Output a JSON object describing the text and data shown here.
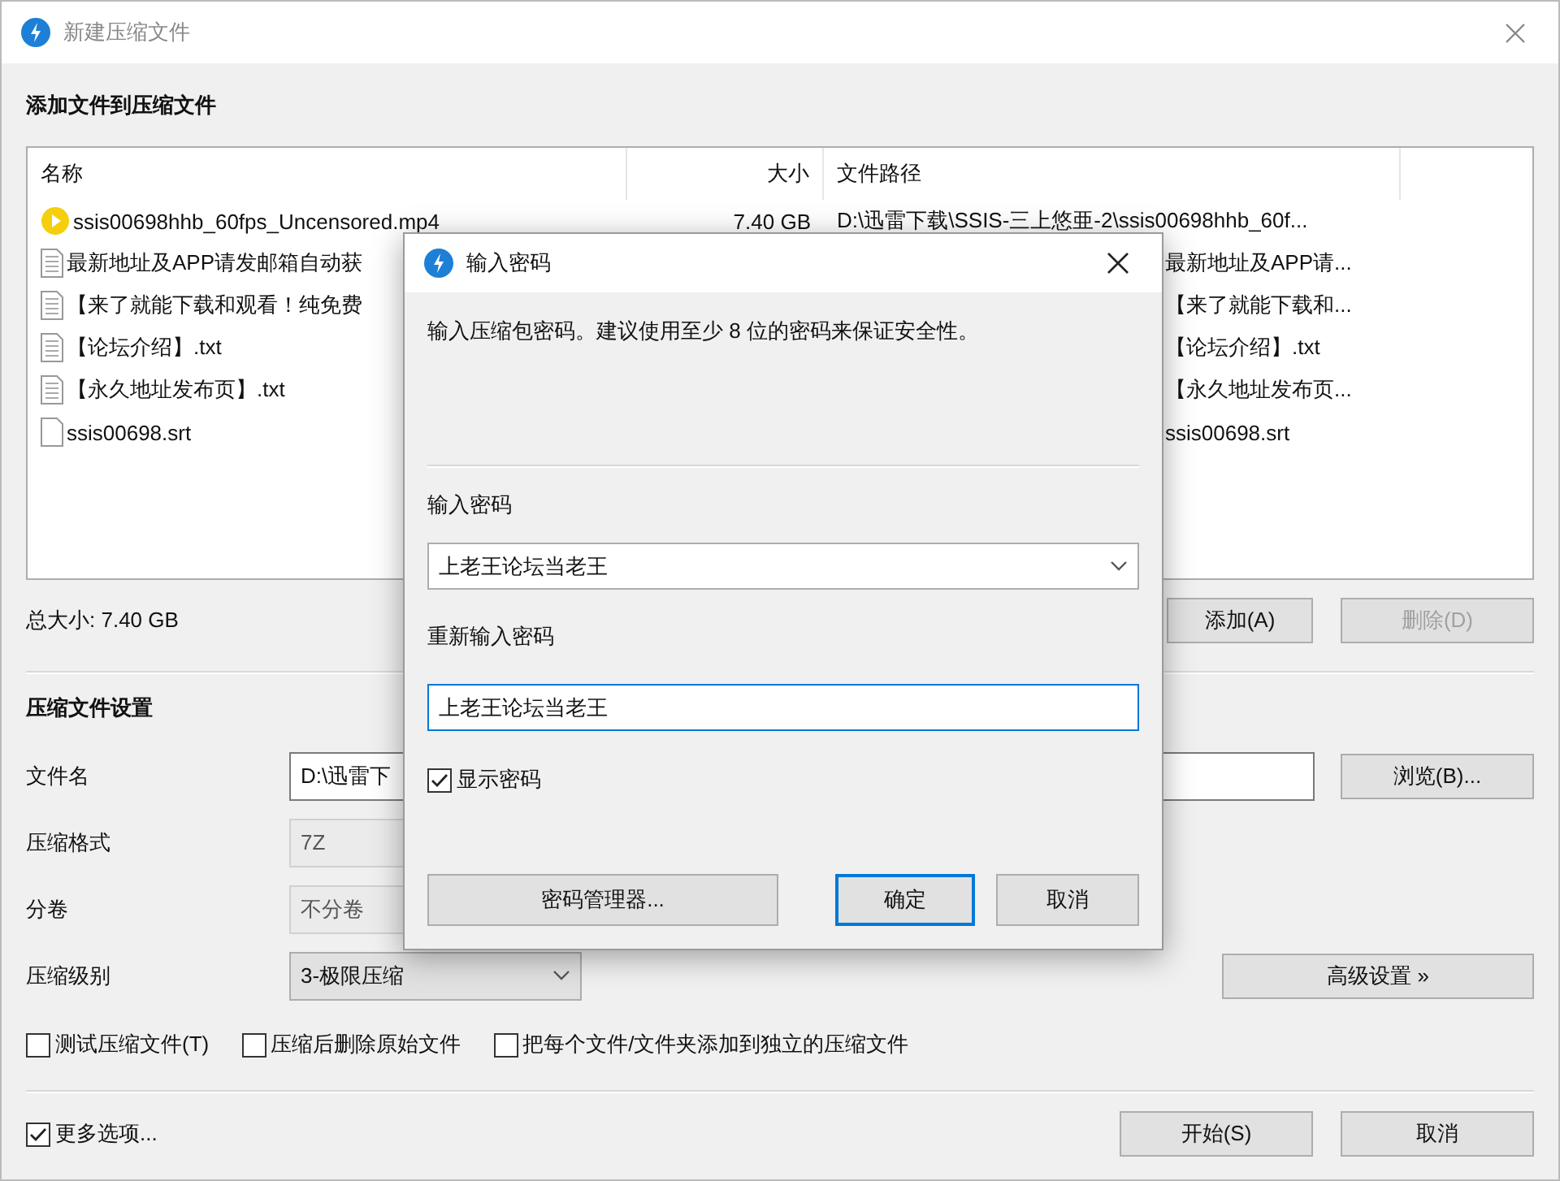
{
  "window": {
    "title": "新建压缩文件"
  },
  "files": {
    "title": "添加文件到压缩文件",
    "columns": [
      "名称",
      "大小",
      "文件路径"
    ],
    "rows": [
      {
        "kind": "video",
        "name": "ssis00698hhb_60fps_Uncensored.mp4",
        "size": "7.40 GB",
        "path": "D:\\迅雷下载\\SSIS-三上悠亜-2\\ssis00698hhb_60f...",
        "path_covered": false
      },
      {
        "kind": "text",
        "name": "最新地址及APP请发邮箱自动获",
        "path": "最新地址及APP请...",
        "path_covered": true
      },
      {
        "kind": "text",
        "name": "【来了就能下载和观看！纯免费",
        "path": "【来了就能下载和...",
        "path_covered": true
      },
      {
        "kind": "text",
        "name": "【论坛介绍】.txt",
        "path": "【论坛介绍】.txt",
        "path_covered": true
      },
      {
        "kind": "text",
        "name": "【永久地址发布页】.txt",
        "path": "【永久地址发布页...",
        "path_covered": true
      },
      {
        "kind": "blank",
        "name": "ssis00698.srt",
        "path": "ssis00698.srt",
        "path_covered": true
      }
    ],
    "total": "总大小: 7.40 GB",
    "buttons": [
      {
        "label": "添加(A)",
        "disabled": false
      },
      {
        "label": "删除(D)",
        "disabled": true
      }
    ]
  },
  "settings": {
    "title": "压缩文件设置",
    "fields": [
      {
        "kind": "text",
        "label": "文件名",
        "value": "D:\\迅雷下"
      },
      {
        "kind": "select",
        "label": "压缩格式",
        "value": "7Z",
        "disabled": true
      },
      {
        "kind": "select",
        "label": "分卷",
        "value": "不分卷",
        "disabled": true
      },
      {
        "kind": "select",
        "label": "压缩级别",
        "value": "3-极限压缩",
        "disabled": false
      }
    ],
    "browse": "浏览(B)...",
    "advanced": "高级设置 »",
    "options": [
      {
        "label": "测试压缩文件(T)",
        "checked": false
      },
      {
        "label": "压缩后删除原始文件",
        "checked": false
      },
      {
        "label": "把每个文件/文件夹添加到独立的压缩文件",
        "checked": false
      }
    ]
  },
  "footer": {
    "more_options": {
      "label": "更多选项...",
      "checked": true
    },
    "buttons": [
      "开始(S)",
      "取消"
    ]
  },
  "dialog": {
    "title": "输入密码",
    "description": "输入压缩包密码。建议使用至少 8 位的密码来保证安全性。",
    "password_label": "输入密码",
    "password": "上老王论坛当老王",
    "confirm_label": "重新输入密码",
    "confirm": "上老王论坛当老王",
    "show_password": {
      "label": "显示密码",
      "checked": true
    },
    "buttons": [
      {
        "kind": "wide",
        "label": "密码管理器..."
      },
      {
        "kind": "default",
        "label": "确定"
      },
      {
        "kind": "normal",
        "label": "取消"
      }
    ]
  }
}
